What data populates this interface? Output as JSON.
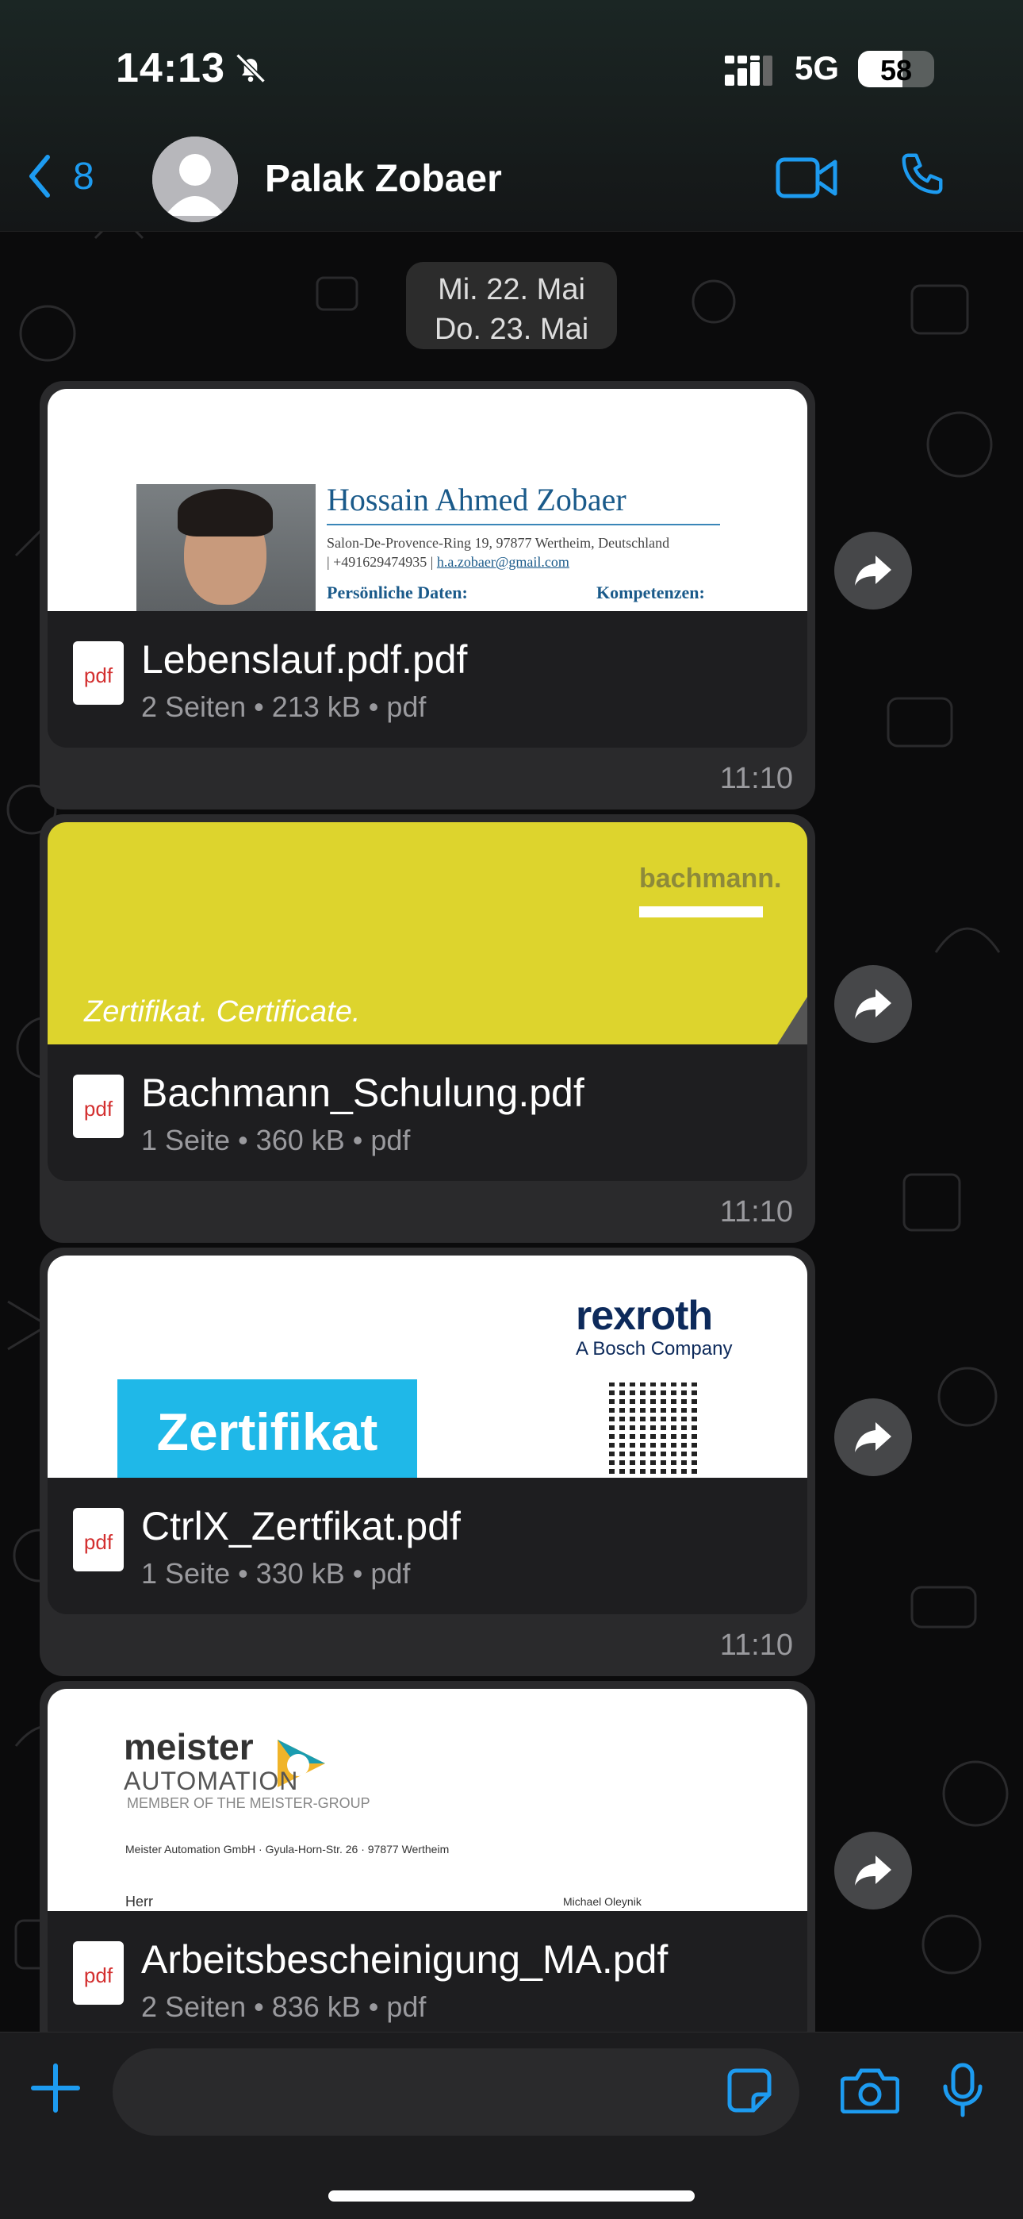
{
  "status_bar": {
    "time": "14:13",
    "network": "5G",
    "battery": "58",
    "battery_level": 0.58
  },
  "header": {
    "back_count": "8",
    "contact_name": "Palak Zobaer"
  },
  "date_pill": {
    "line1": "Mi. 22. Mai",
    "line2": "Do. 23. Mai"
  },
  "messages": [
    {
      "file_name": "Lebenslauf.pdf.pdf",
      "meta": "2 Seiten • 213 kB • pdf",
      "time": "11:10",
      "icon_label": "pdf",
      "preview": {
        "name": "Hossain Ahmed Zobaer",
        "address": "Salon-De-Provence-Ring 19, 97877 Wertheim, Deutschland",
        "phone": "| +491629474935 |",
        "email": "h.a.zobaer@gmail.com",
        "heading_left": "Persönliche Daten:",
        "heading_right": "Kompetenzen:"
      }
    },
    {
      "file_name": "Bachmann_Schulung.pdf",
      "meta": "1 Seite • 360 kB • pdf",
      "time": "11:10",
      "icon_label": "pdf",
      "preview": {
        "logo": "bachmann.",
        "caption": "Zertifikat. Certificate."
      }
    },
    {
      "file_name": "CtrlX_Zertfikat.pdf",
      "meta": "1 Seite • 330 kB • pdf",
      "time": "11:10",
      "icon_label": "pdf",
      "preview": {
        "logo": "rexroth",
        "sublogo": "A Bosch Company",
        "title": "Zertifikat"
      }
    },
    {
      "file_name": "Arbeitsbescheinigung_MA.pdf",
      "meta": "2 Seiten • 836 kB • pdf",
      "icon_label": "pdf",
      "preview": {
        "logo": "meister",
        "logo_sub": "AUTOMATION",
        "member": "MEMBER OF THE MEISTER-GROUP",
        "address": "Meister Automation GmbH · Gyula-Horn-Str. 26 · 97877 Wertheim",
        "salutation": "Herr",
        "contact": "Michael Oleynik"
      }
    }
  ],
  "colors": {
    "accent": "#1d9bf0",
    "bubble": "#2a2a2c",
    "file_bar": "#1e1e20",
    "rexroth_blue": "#1fb8e8",
    "bachmann_yellow": "#ddd42d"
  }
}
